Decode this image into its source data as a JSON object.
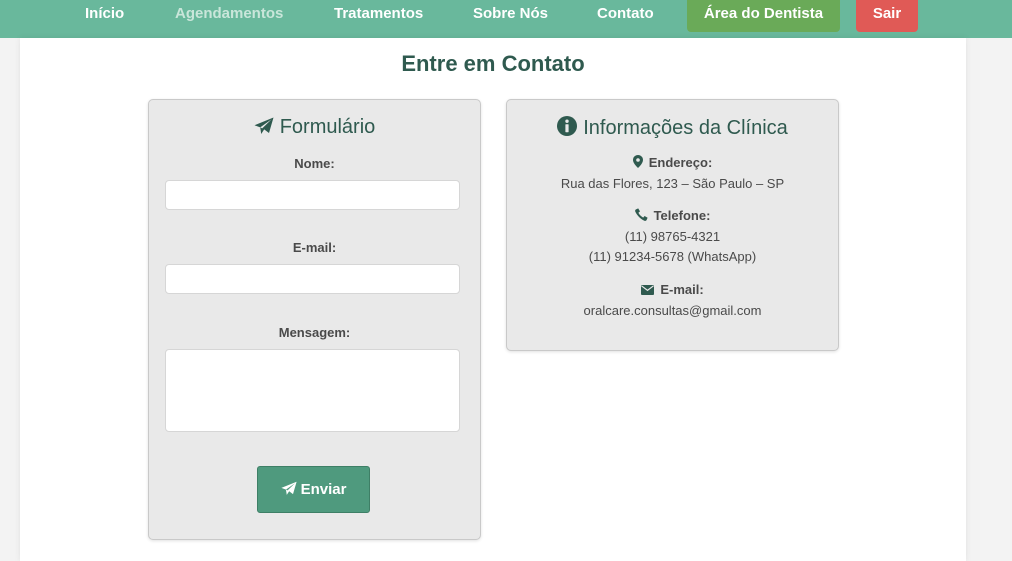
{
  "nav": {
    "links": [
      {
        "label": "Início"
      },
      {
        "label": "Agendamentos"
      },
      {
        "label": "Tratamentos"
      },
      {
        "label": "Sobre Nós"
      },
      {
        "label": "Contato"
      }
    ],
    "dentist_button": "Área do Dentista",
    "logout_button": "Sair"
  },
  "page": {
    "title": "Entre em Contato"
  },
  "form": {
    "title": "Formulário",
    "name_label": "Nome:",
    "name_value": "",
    "email_label": "E-mail:",
    "email_value": "",
    "message_label": "Mensagem:",
    "message_value": "",
    "submit_label": "Enviar"
  },
  "info": {
    "title": "Informações da Clínica",
    "address_label": "Endereço:",
    "address_value": "Rua das Flores, 123 – São Paulo – SP",
    "phone_label": "Telefone:",
    "phone_1": "(11) 98765-4321",
    "phone_2": "(11) 91234-5678 (WhatsApp)",
    "email_label": "E-mail:",
    "email_value": "oralcare.consultas@gmail.com"
  },
  "colors": {
    "navbar": "#69b89c",
    "dentist_button": "#6aaa58",
    "logout_button": "#e05a56",
    "heading": "#2f5a4f",
    "submit_button": "#4f9a7e"
  },
  "icons": {
    "form_title": "paper-plane-icon",
    "info_title": "info-circle-icon",
    "address": "map-marker-icon",
    "phone": "phone-icon",
    "email": "envelope-icon",
    "submit": "paper-plane-icon"
  }
}
